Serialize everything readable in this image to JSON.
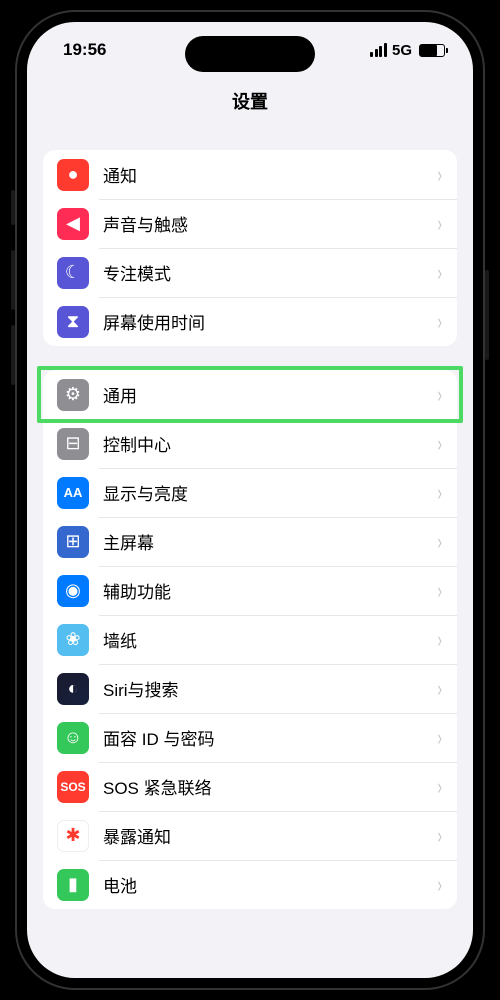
{
  "statusBar": {
    "time": "19:56",
    "network": "5G"
  },
  "header": {
    "title": "设置"
  },
  "groups": [
    {
      "items": [
        {
          "id": "notifications",
          "label": "通知",
          "iconName": "bell-icon",
          "iconBg": "bg-red",
          "glyph": "●"
        },
        {
          "id": "sound-haptics",
          "label": "声音与触感",
          "iconName": "speaker-icon",
          "iconBg": "bg-pink",
          "glyph": "◀"
        },
        {
          "id": "focus",
          "label": "专注模式",
          "iconName": "moon-icon",
          "iconBg": "bg-indigo",
          "glyph": "☾"
        },
        {
          "id": "screen-time",
          "label": "屏幕使用时间",
          "iconName": "hourglass-icon",
          "iconBg": "bg-indigo",
          "glyph": "⧗"
        }
      ]
    },
    {
      "items": [
        {
          "id": "general",
          "label": "通用",
          "iconName": "gear-icon",
          "iconBg": "bg-gray",
          "glyph": "⚙",
          "highlighted": true
        },
        {
          "id": "control-center",
          "label": "控制中心",
          "iconName": "switches-icon",
          "iconBg": "bg-gray",
          "glyph": "⊟"
        },
        {
          "id": "display-brightness",
          "label": "显示与亮度",
          "iconName": "text-size-icon",
          "iconBg": "bg-blue",
          "glyph": "AA"
        },
        {
          "id": "home-screen",
          "label": "主屏幕",
          "iconName": "grid-icon",
          "iconBg": "bg-home",
          "glyph": "⊞"
        },
        {
          "id": "accessibility",
          "label": "辅助功能",
          "iconName": "accessibility-icon",
          "iconBg": "bg-blue",
          "glyph": "◉"
        },
        {
          "id": "wallpaper",
          "label": "墙纸",
          "iconName": "flower-icon",
          "iconBg": "bg-cyan",
          "glyph": "❀"
        },
        {
          "id": "siri-search",
          "label": "Siri与搜索",
          "iconName": "siri-icon",
          "iconBg": "bg-siri",
          "glyph": "◐"
        },
        {
          "id": "face-id-passcode",
          "label": "面容 ID 与密码",
          "iconName": "faceid-icon",
          "iconBg": "bg-green",
          "glyph": "☺"
        },
        {
          "id": "emergency-sos",
          "label": "SOS 紧急联络",
          "iconName": "sos-icon",
          "iconBg": "bg-sos",
          "glyph": "SOS"
        },
        {
          "id": "exposure-notifications",
          "label": "暴露通知",
          "iconName": "virus-icon",
          "iconBg": "bg-white",
          "glyph": "✱"
        },
        {
          "id": "battery",
          "label": "电池",
          "iconName": "battery-icon",
          "iconBg": "bg-green",
          "glyph": "▮"
        }
      ]
    }
  ]
}
